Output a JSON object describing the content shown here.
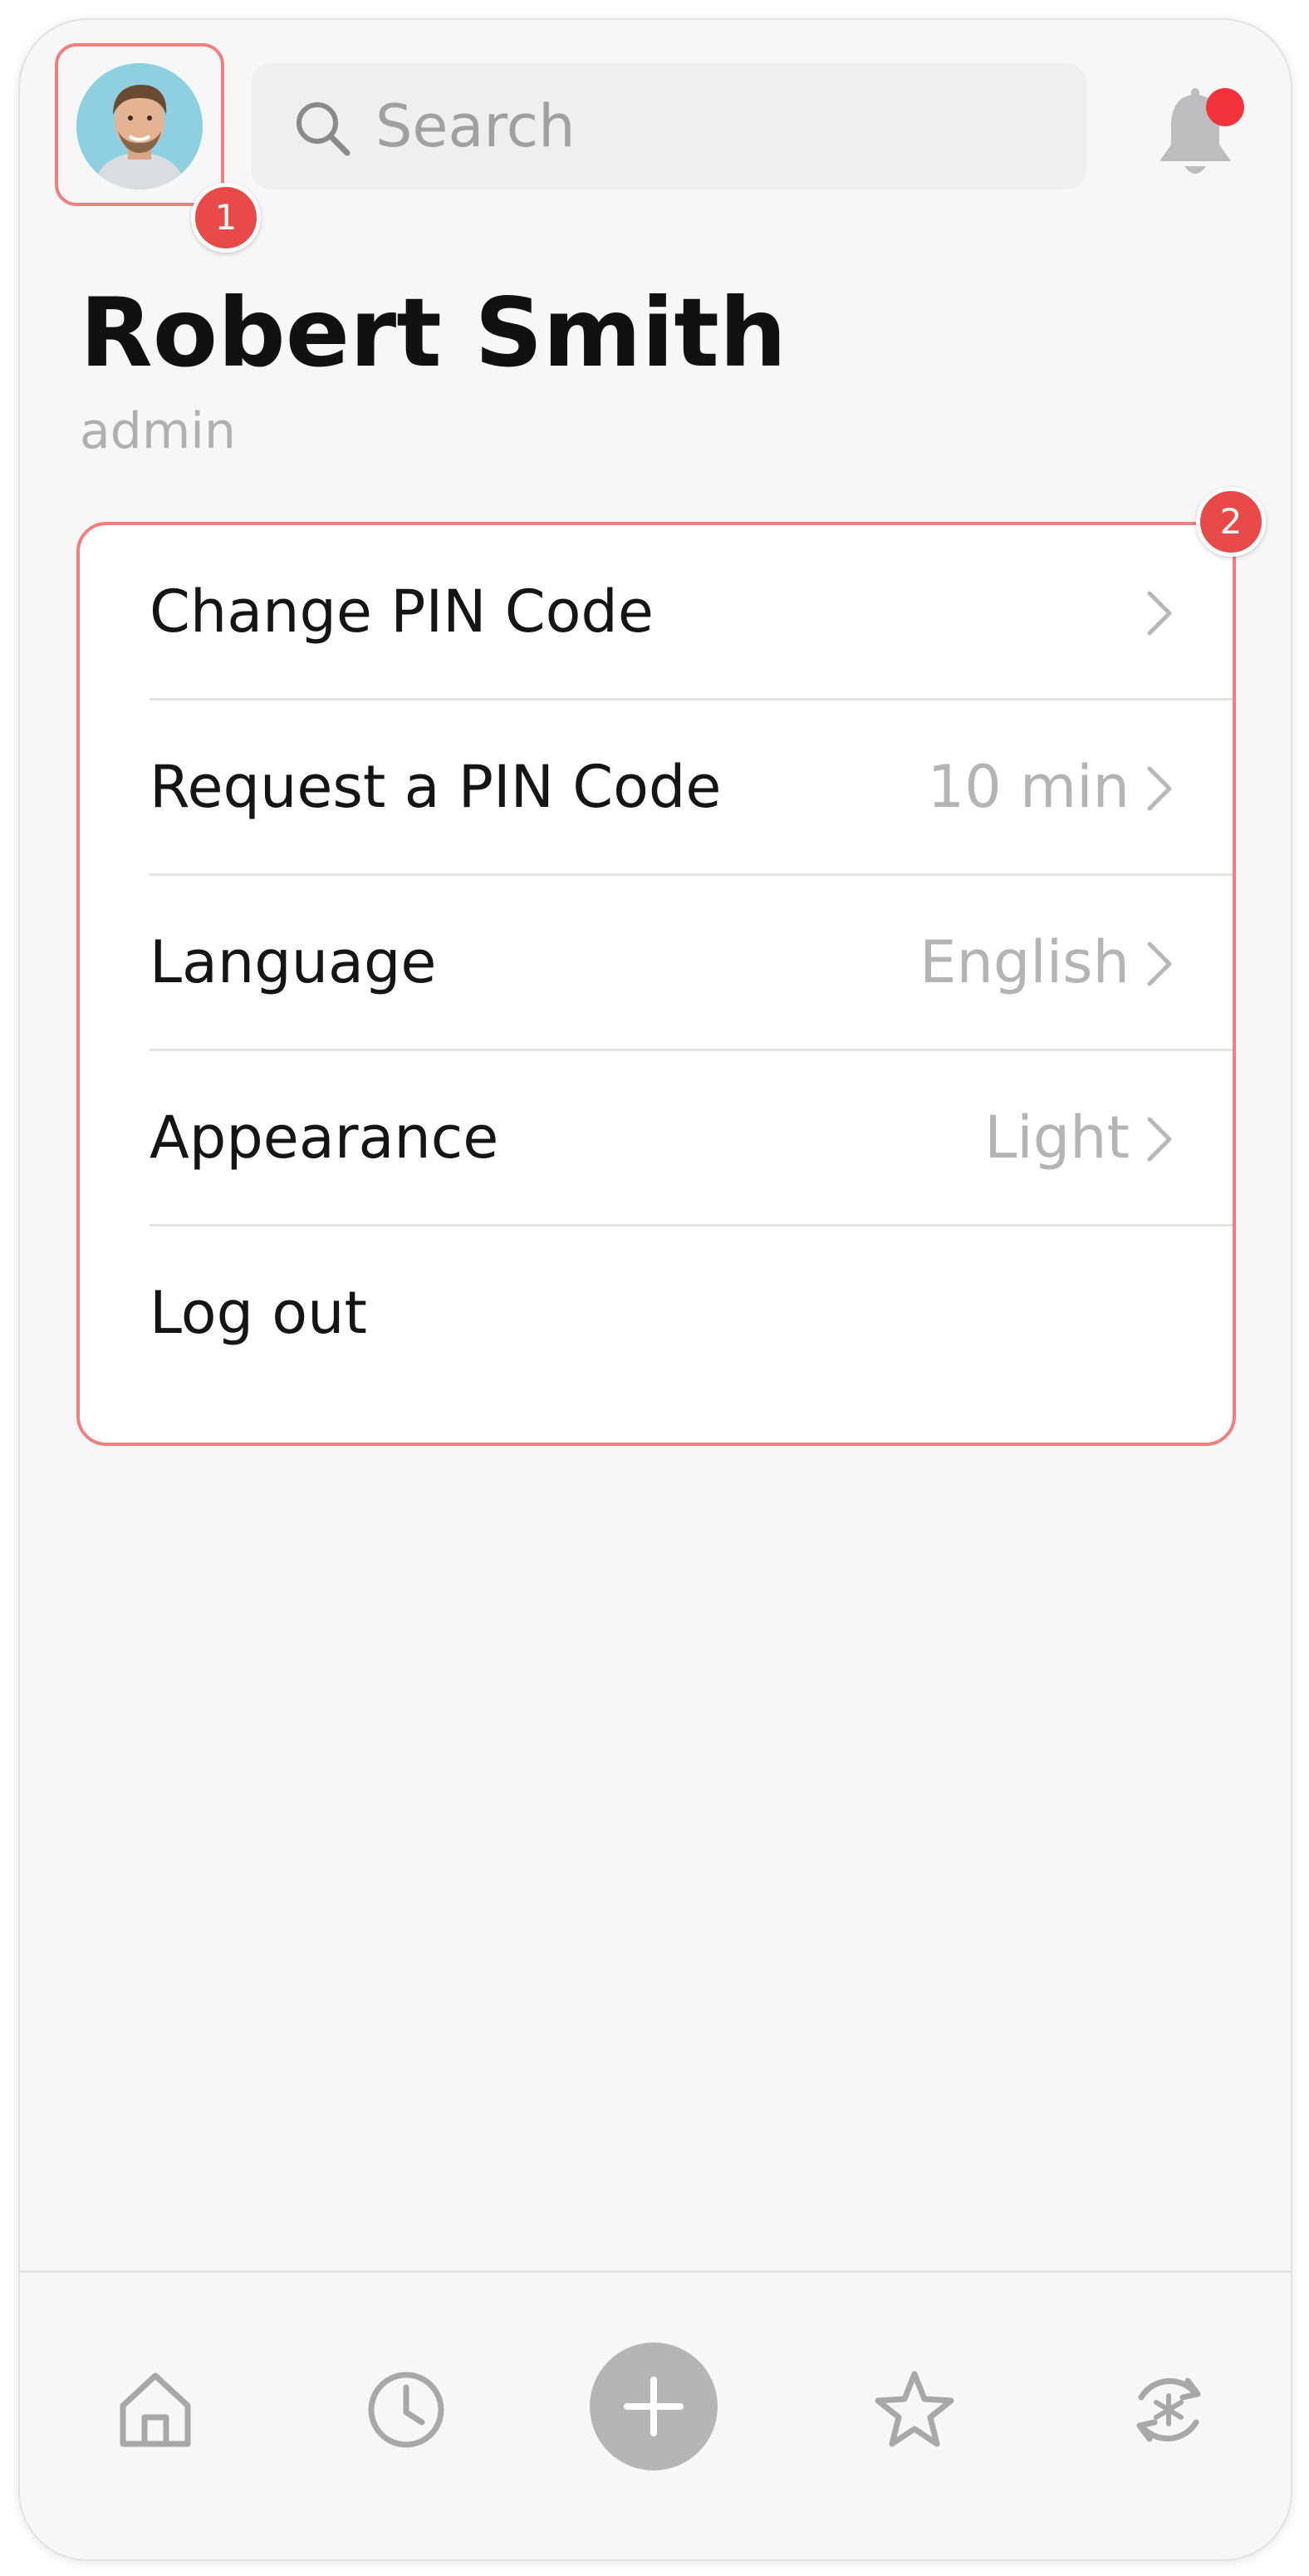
{
  "header": {
    "avatar_alt": "Profile photo",
    "search_placeholder": "Search",
    "notification_dot": true
  },
  "annotations": {
    "badge_1": "1",
    "badge_2": "2",
    "highlight_color": "#f08080",
    "badge_color": "#e84a4a"
  },
  "profile": {
    "name": "Robert Smith",
    "role": "admin"
  },
  "settings": {
    "items": [
      {
        "label": "Change PIN Code",
        "value": "",
        "chevron": true
      },
      {
        "label": "Request a PIN Code",
        "value": "10 min",
        "chevron": true
      },
      {
        "label": "Language",
        "value": "English",
        "chevron": true
      },
      {
        "label": "Appearance",
        "value": "Light",
        "chevron": true
      },
      {
        "label": "Log out",
        "value": "",
        "chevron": false
      }
    ]
  },
  "nav": {
    "items": [
      "home-icon",
      "clock-icon",
      "plus-icon",
      "star-icon",
      "sync-icon"
    ],
    "accent": "#b5b5b5"
  }
}
